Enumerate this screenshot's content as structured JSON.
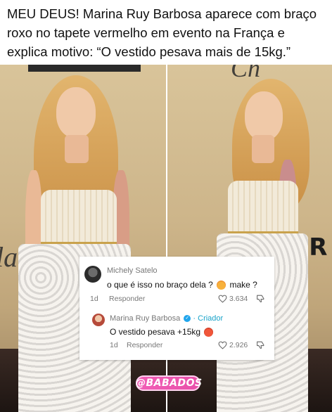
{
  "headline": {
    "text": "MEU DEUS! Marina Ruy Barbosa aparece com braço roxo no tapete vermelho em evento na França e explica motivo: “O vestido pesava mais de 15kg.”"
  },
  "backdrop": {
    "left_script": "la",
    "right_script": "Ch",
    "right_block": "ER"
  },
  "comments": [
    {
      "author": "Michely Satelo",
      "text_before": "o que é isso no braço dela ?",
      "emoji": "hot-face-emoji",
      "text_after": "make ?",
      "time": "1d",
      "reply_label": "Responder",
      "likes": "3.634",
      "like_icon": "heart-outline-icon",
      "dislike_icon": "thumbs-down-outline-icon"
    },
    {
      "author": "Marina Ruy Barbosa",
      "badge_icon": "verified-check-icon",
      "role": "· Criador",
      "text": "O vestido pesava +15kg",
      "emoji": "angry-face-emoji",
      "time": "1d",
      "reply_label": "Responder",
      "likes": "2.926",
      "like_icon": "heart-outline-icon",
      "dislike_icon": "thumbs-down-outline-icon"
    }
  ],
  "watermark": {
    "text": "@BABADOS"
  },
  "colors": {
    "creator": "#1aa3c9",
    "watermark": "#f25fb7",
    "verified": "#20a5ec"
  }
}
